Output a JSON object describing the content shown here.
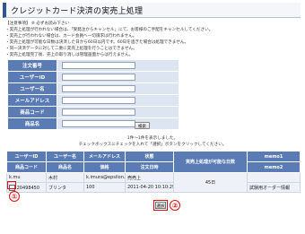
{
  "header": {
    "title": "クレジットカード決済の実売上処理"
  },
  "notes": [
    "【注意事項】 ※ 必ずお読み下さい",
    "・実売上処理が行われない場合は、「受発注からキャンセル」にて、お客様のご手配をキャンセルしてください。",
    "・実売上が行われない場合は、カード会員へ一切請求は行われません。",
    "・実売上処理が可能な日数は決済した日から60日以内です。60日を過ぎた場合は処理できません。",
    "・同一決済データに対して二重に実売上処理を行うことはできません。",
    "・実売上処理完了後、売上の取り消しは管理画面からは行えません。"
  ],
  "search": {
    "labels": [
      "注文番号",
      "ユーザーID",
      "ユーザー名",
      "メールアドレス",
      "商品コード",
      "商品名"
    ],
    "button": "検索"
  },
  "results": {
    "count_text": "1件～1件を表示しました。",
    "instruction": "チェックボックスにチェックを入れて「選択」ボタンをクリックしてください。",
    "headers": {
      "user_id": "ユーザーID",
      "user_name": "ユーザー名",
      "email": "メールアドレス",
      "status": "状態",
      "days_left": "実売上処理が可能な日数",
      "memo1": "memo1",
      "product_code": "商品コード",
      "product_name": "商品名",
      "price": "価格",
      "order_date": "注文日時",
      "memo2": "memo2"
    },
    "row": {
      "user_id": "k.mu",
      "user_name": "木村",
      "email": "k.imura@epsilon.jp",
      "status": "売売上",
      "days_left": "45日",
      "memo1": "",
      "product_code": "20498450",
      "product_name": "ブリンタ",
      "price": "100",
      "order_date": "2011-04-20 10:10:29",
      "memo2": "試験用オーダー情報"
    },
    "select_button": "選択"
  },
  "annotations": {
    "circle1": "①",
    "circle2": "②",
    "accent_color": "#e01010"
  }
}
